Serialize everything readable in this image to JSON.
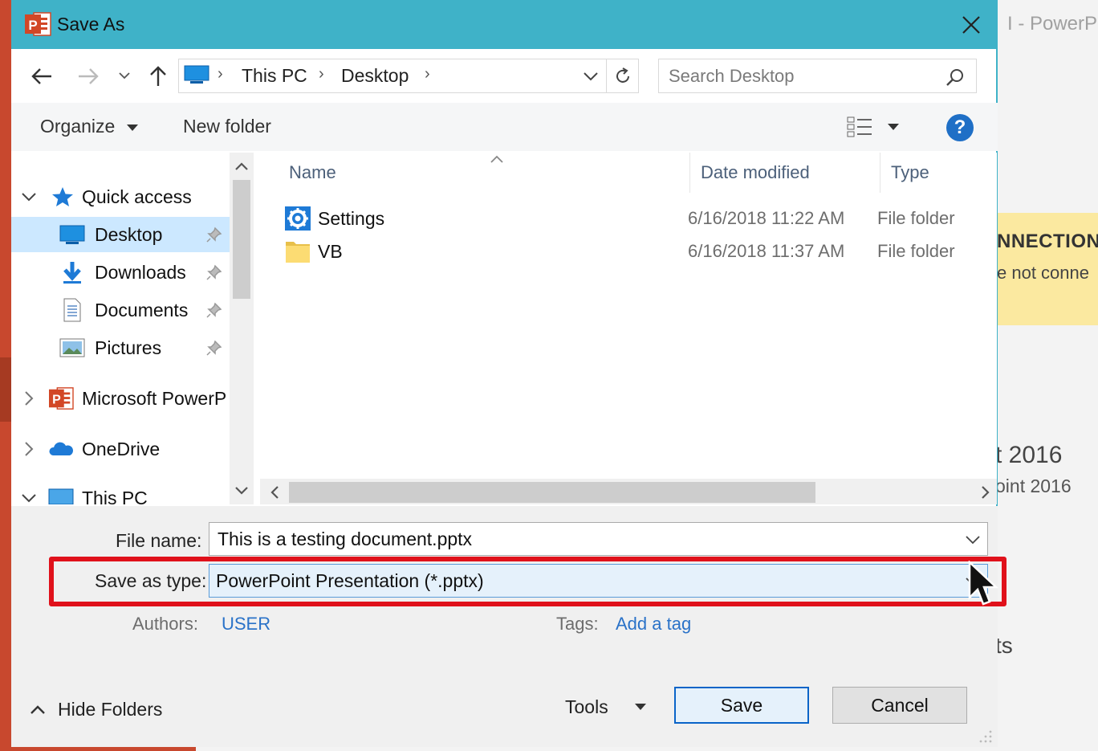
{
  "background": {
    "app_title_fragment": "I  -  PowerPo",
    "warning_line1": "NNECTION",
    "warning_line2": "e not conne",
    "text1": "t 2016",
    "text2": "oint 2016",
    "text3": "ts"
  },
  "dialog": {
    "title": "Save As",
    "accent_color": "#3fb2c8"
  },
  "navigation": {
    "breadcrumb": [
      "This PC",
      "Desktop"
    ],
    "search_placeholder": "Search Desktop"
  },
  "commandbar": {
    "organize_label": "Organize",
    "new_folder_label": "New folder",
    "help_label": "?"
  },
  "navpane": {
    "items": [
      {
        "label": "Quick access",
        "icon": "star-icon",
        "expanded": true
      },
      {
        "label": "Desktop",
        "icon": "desktop-icon",
        "pinned": true,
        "selected": true
      },
      {
        "label": "Downloads",
        "icon": "download-arrow-icon",
        "pinned": true
      },
      {
        "label": "Documents",
        "icon": "document-icon",
        "pinned": true
      },
      {
        "label": "Pictures",
        "icon": "pictures-icon",
        "pinned": true
      },
      {
        "label": "Microsoft PowerP",
        "icon": "powerpoint-icon",
        "expanded": false
      },
      {
        "label": "OneDrive",
        "icon": "onedrive-cloud-icon",
        "expanded": false
      },
      {
        "label": "This PC",
        "icon": "computer-icon",
        "expanded": true
      }
    ]
  },
  "filelist": {
    "columns": [
      "Name",
      "Date modified",
      "Type"
    ],
    "rows": [
      {
        "name": "Settings",
        "icon": "gear-icon",
        "date": "6/16/2018 11:22 AM",
        "type": "File folder"
      },
      {
        "name": "VB",
        "icon": "folder-icon",
        "date": "6/16/2018 11:37 AM",
        "type": "File folder"
      }
    ]
  },
  "form": {
    "file_name_label": "File name:",
    "file_name_value": "This is a testing document.pptx",
    "save_as_type_label": "Save as type:",
    "save_as_type_value": "PowerPoint Presentation (*.pptx)",
    "authors_label": "Authors:",
    "authors_value": "USER",
    "tags_label": "Tags:",
    "tags_value": "Add a tag",
    "hide_folders_label": "Hide Folders",
    "tools_label": "Tools",
    "save_label": "Save",
    "cancel_label": "Cancel",
    "highlight_color": "#e0111b"
  }
}
